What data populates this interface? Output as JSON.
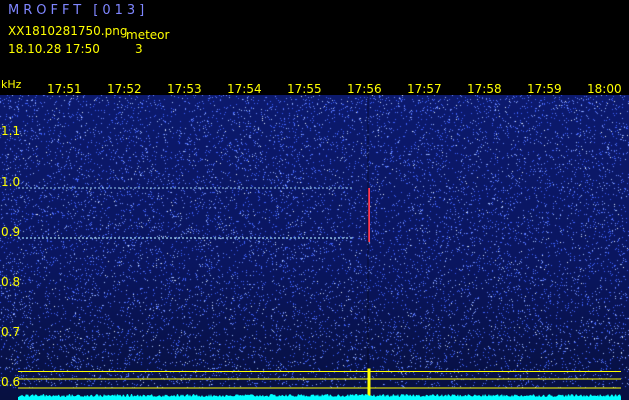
{
  "header": {
    "app_title": "MROFFT [013]",
    "filename": "XX1810281750.png",
    "timestamp": "18.10.28 17:50",
    "event_label": "meteor",
    "event_count": "3"
  },
  "axes": {
    "y_unit": "kHz",
    "y_ticks": [
      "1.1",
      "1.0",
      "0.9",
      "0.8",
      "0.7",
      "0.6"
    ],
    "x_ticks": [
      "17:51",
      "17:52",
      "17:53",
      "17:54",
      "17:55",
      "17:56",
      "17:57",
      "17:58",
      "17:59",
      "18:00"
    ]
  },
  "spectrogram": {
    "background_color": "#0a1660",
    "noise_color": "#3f63ff",
    "signal_color": "#aee9ff",
    "meteor_color": "#ff3a5a",
    "baseline_color": "#00ffff",
    "marker_color": "#ffff00",
    "carrier_lines_khz": [
      0.99,
      0.89
    ],
    "carrier_end_time": "17:55:48",
    "meteor_time": "17:56:04",
    "meteor_khz_range": [
      0.89,
      0.99
    ],
    "reference_lines_khz": [
      0.623,
      0.608,
      0.59
    ]
  }
}
